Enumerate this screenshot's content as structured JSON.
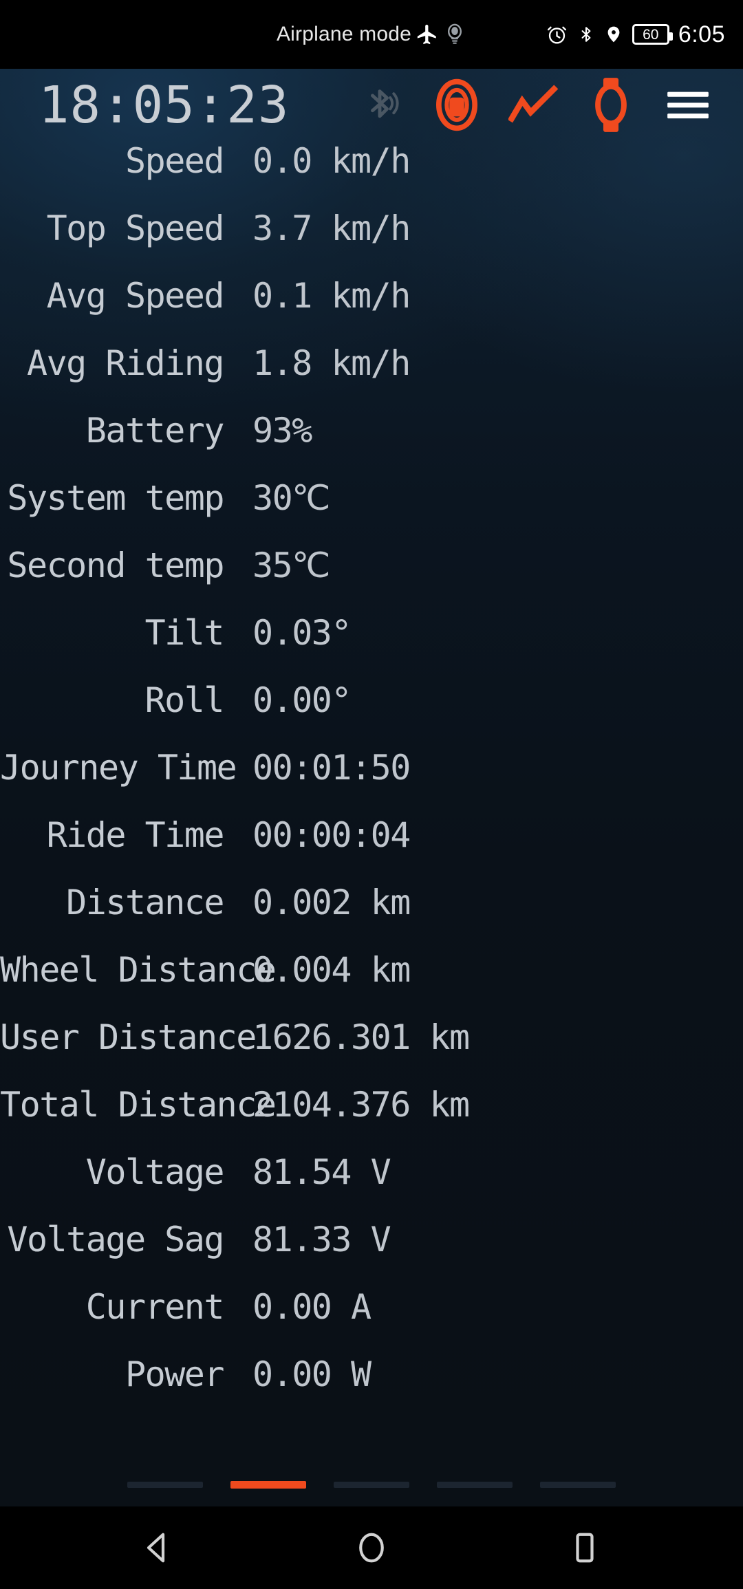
{
  "status_bar": {
    "airplane_label": "Airplane mode",
    "airplane_icon": "airplane-icon",
    "headset_icon": "headset-icon",
    "alarm_icon": "alarm-icon",
    "bluetooth_icon": "bluetooth-icon",
    "location_icon": "location-pin-icon",
    "battery_level": "60",
    "clock": "6:05"
  },
  "app_bar": {
    "clock": "18:05:23",
    "icons": [
      {
        "name": "bluetooth-disconnected-icon",
        "label": "Bluetooth"
      },
      {
        "name": "euc-wheel-icon",
        "label": "Wheel"
      },
      {
        "name": "chart-trend-icon",
        "label": "Chart"
      },
      {
        "name": "smartwatch-icon",
        "label": "Watch"
      },
      {
        "name": "menu-icon",
        "label": "Menu"
      }
    ],
    "accent_color": "#f04a1e"
  },
  "metrics": [
    {
      "label": "Speed",
      "value": "0.0 km/h"
    },
    {
      "label": "Top Speed",
      "value": "3.7 km/h"
    },
    {
      "label": "Avg Speed",
      "value": "0.1 km/h"
    },
    {
      "label": "Avg Riding",
      "value": "1.8 km/h"
    },
    {
      "label": "Battery",
      "value": "93%"
    },
    {
      "label": "System temp",
      "value": "30℃"
    },
    {
      "label": "Second temp",
      "value": "35℃"
    },
    {
      "label": "Tilt",
      "value": "0.03°"
    },
    {
      "label": "Roll",
      "value": "0.00°"
    },
    {
      "label": "Journey Time",
      "value": "00:01:50"
    },
    {
      "label": "Ride Time",
      "value": "00:00:04"
    },
    {
      "label": "Distance",
      "value": "0.002 km"
    },
    {
      "label": "Wheel Distance",
      "value": "0.004 km"
    },
    {
      "label": "User Distance",
      "value": "1626.301 km"
    },
    {
      "label": "Total Distance",
      "value": "2104.376 km"
    },
    {
      "label": "Voltage",
      "value": "81.54 V"
    },
    {
      "label": "Voltage Sag",
      "value": "81.33 V"
    },
    {
      "label": "Current",
      "value": "0.00 A"
    },
    {
      "label": "Power",
      "value": "0.00 W"
    }
  ],
  "pager": {
    "count": 5,
    "active_index": 1,
    "active_color": "#f04a1e",
    "inactive_color": "#1c2530"
  },
  "nav_bar": {
    "back_icon": "back-triangle-icon",
    "home_icon": "home-circle-icon",
    "recents_icon": "recents-square-icon"
  }
}
